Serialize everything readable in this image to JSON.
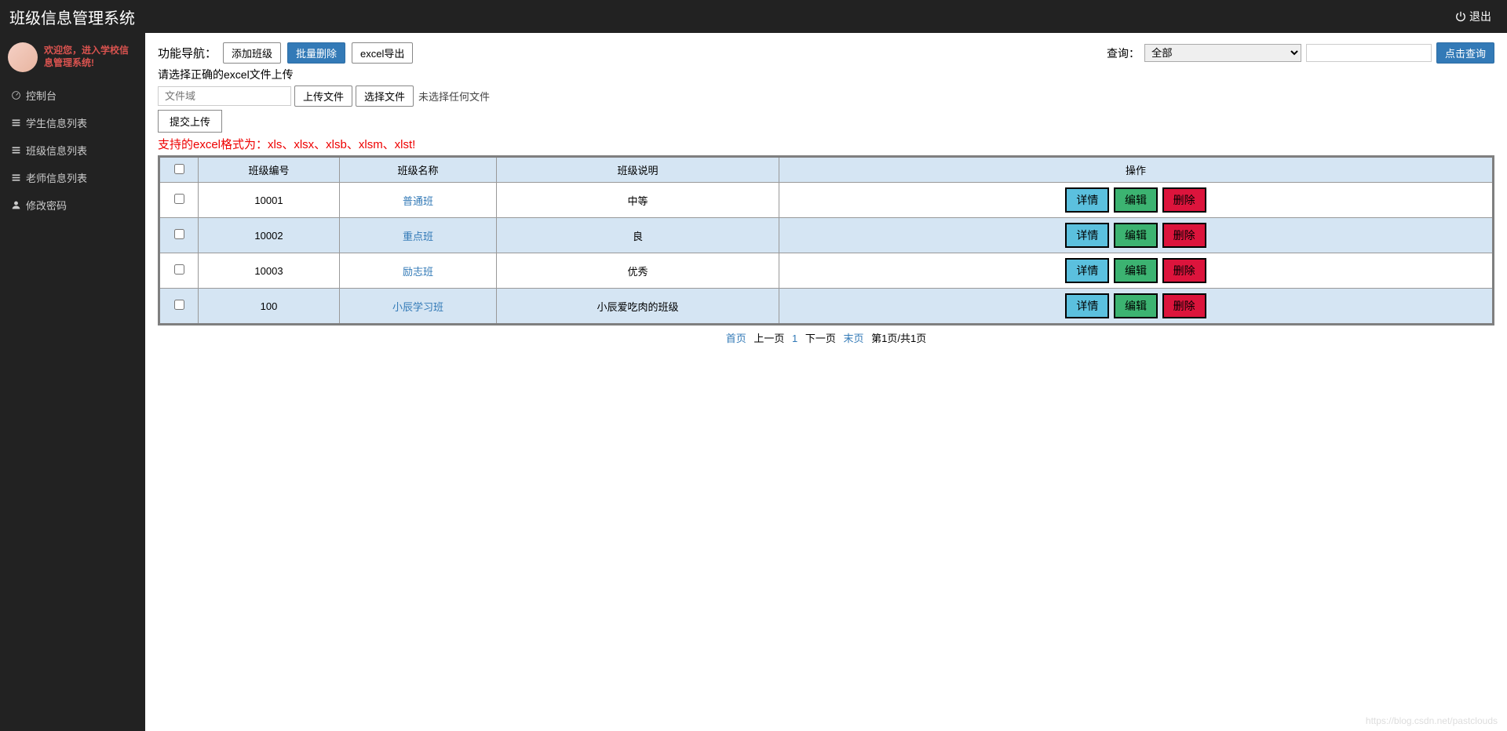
{
  "header": {
    "title": "班级信息管理系统",
    "logout": "退出"
  },
  "sidebar": {
    "welcome": "欢迎您，进入学校信息管理系统!",
    "items": [
      {
        "label": "控制台",
        "icon": "dashboard"
      },
      {
        "label": "学生信息列表",
        "icon": "list"
      },
      {
        "label": "班级信息列表",
        "icon": "list"
      },
      {
        "label": "老师信息列表",
        "icon": "list"
      },
      {
        "label": "修改密码",
        "icon": "user"
      }
    ]
  },
  "toolbar": {
    "nav_label": "功能导航：",
    "add_label": "添加班级",
    "batch_delete_label": "批量删除",
    "export_label": "excel导出",
    "query_label": "查询：",
    "query_option": "全部",
    "query_button": "点击查询"
  },
  "upload": {
    "hint": "请选择正确的excel文件上传",
    "file_placeholder": "文件域",
    "upload_btn": "上传文件",
    "choose_btn": "选择文件",
    "no_file": "未选择任何文件",
    "submit_btn": "提交上传",
    "format_hint": "支持的excel格式为：xls、xlsx、xlsb、xlsm、xlst!"
  },
  "table": {
    "headers": {
      "id": "班级编号",
      "name": "班级名称",
      "desc": "班级说明",
      "action": "操作"
    },
    "actions": {
      "detail": "详情",
      "edit": "编辑",
      "delete": "删除"
    },
    "rows": [
      {
        "id": "10001",
        "name": "普通班",
        "desc": "中等"
      },
      {
        "id": "10002",
        "name": "重点班",
        "desc": "良"
      },
      {
        "id": "10003",
        "name": "励志班",
        "desc": "优秀"
      },
      {
        "id": "100",
        "name": "小辰学习班",
        "desc": "小辰爱吃肉的班级"
      }
    ]
  },
  "pagination": {
    "first": "首页",
    "prev": "上一页",
    "current": "1",
    "next": "下一页",
    "last": "末页",
    "info": "第1页/共1页"
  },
  "watermark": "https://blog.csdn.net/pastclouds"
}
